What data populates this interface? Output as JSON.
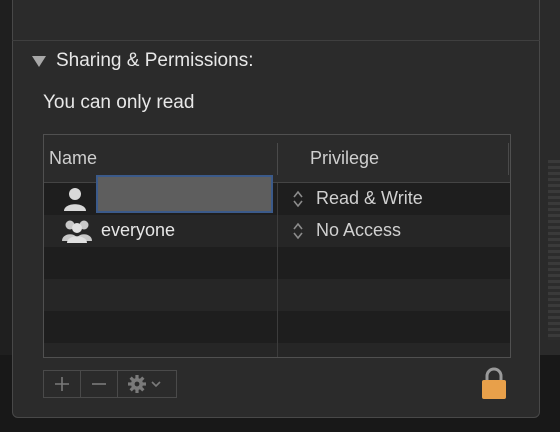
{
  "panel": {
    "section_title": "Sharing & Permissions:",
    "read_note": "You can only read"
  },
  "table": {
    "columns": [
      "Name",
      "Privilege"
    ],
    "rows": [
      {
        "name": "",
        "privilege": "Read & Write",
        "icon": "single-user-icon",
        "name_obscured": true
      },
      {
        "name": "everyone",
        "privilege": "No Access",
        "icon": "group-users-icon",
        "name_obscured": false
      }
    ]
  },
  "controls": {
    "add_icon": "plus-icon",
    "remove_icon": "minus-icon",
    "action_icon": "gear-icon",
    "lock_icon": "lock-icon"
  },
  "colors": {
    "lock": "#e8a04a",
    "selection_border": "#3b5a8a"
  }
}
